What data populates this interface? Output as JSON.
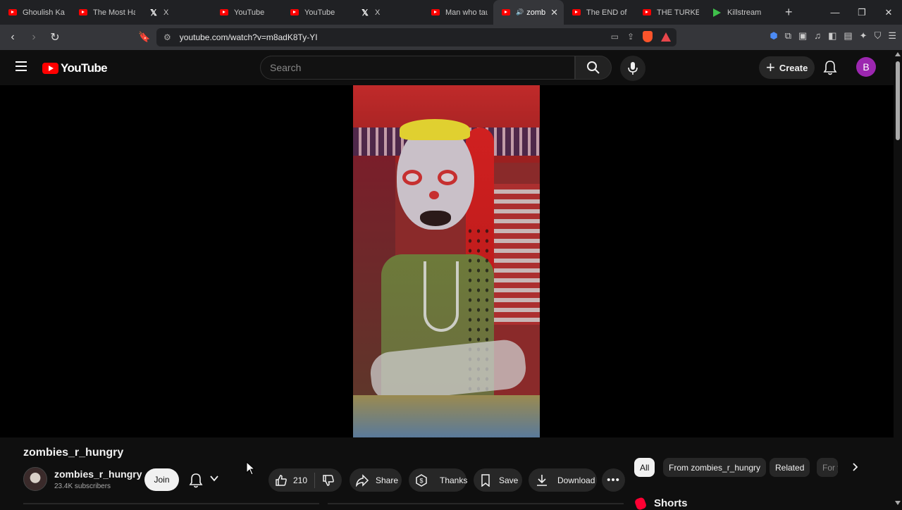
{
  "browser": {
    "tabs": [
      {
        "label": "Ghoulish Kare",
        "icon": "youtube-icon"
      },
      {
        "label": "The Most Hat",
        "icon": "youtube-icon"
      },
      {
        "label": "X",
        "icon": "x-icon"
      },
      {
        "label": "YouTube",
        "icon": "youtube-icon"
      },
      {
        "label": "YouTube",
        "icon": "youtube-icon"
      },
      {
        "label": "X",
        "icon": "x-icon"
      },
      {
        "label": "Man who tau",
        "icon": "youtube-icon"
      },
      {
        "label": "zomb",
        "icon": "youtube-icon",
        "active": true
      },
      {
        "label": "The END of L",
        "icon": "youtube-icon"
      },
      {
        "label": "THE TURKEY",
        "icon": "youtube-icon"
      },
      {
        "label": "Killstream",
        "icon": "killstream-icon"
      }
    ],
    "new_tab": "+",
    "url": "youtube.com/watch?v=m8adK8Ty-YI"
  },
  "youtube": {
    "logo_text": "YouTube",
    "search_placeholder": "Search",
    "create_label": "Create",
    "avatar_letter": "B",
    "accent": "#ff0000"
  },
  "video": {
    "title": "zombies_r_hungry",
    "channel": {
      "name": "zombies_r_hungry",
      "subscribers": "23.4K subscribers"
    },
    "join_label": "Join",
    "likes": "210",
    "actions": {
      "share": "Share",
      "thanks": "Thanks",
      "save": "Save",
      "download": "Download"
    }
  },
  "sidebar": {
    "chips": [
      "All",
      "From zombies_r_hungry",
      "Related",
      "For y"
    ],
    "shorts_heading": "Shorts"
  }
}
